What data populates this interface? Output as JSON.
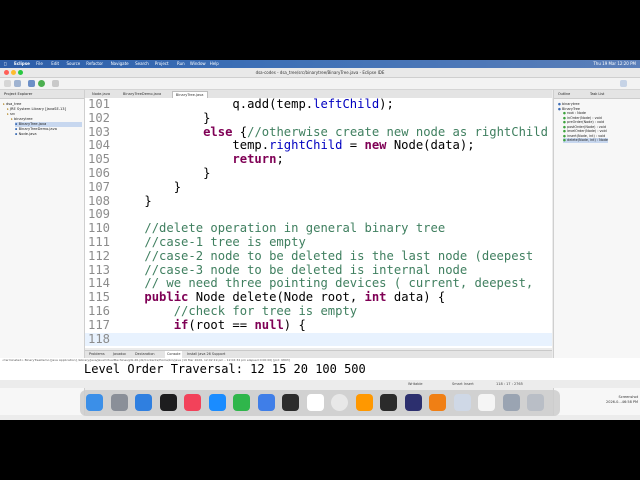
{
  "menubar": {
    "items": [
      "Eclipse",
      "File",
      "Edit",
      "Source",
      "Refactor",
      "Navigate",
      "Search",
      "Project",
      "Run",
      "Window",
      "Help"
    ],
    "clock": "Thu 19 Mar 12:20 PM"
  },
  "window": {
    "title": "dsa-codes - dsa_tree/src/binarytree/BinaryTree.java - Eclipse IDE"
  },
  "colors": {
    "menubar": "#2d5ea8",
    "keyword": "#7f0055",
    "comment": "#3f7f5f",
    "field": "#0000c0",
    "line_number": "#8c8c8c",
    "selection": "#c7d7ef"
  },
  "project_explorer": {
    "title": "Project Explorer",
    "items": [
      {
        "label": "dsa_tree",
        "depth": 0
      },
      {
        "label": "JRE System Library [JavaSE-13]",
        "depth": 1
      },
      {
        "label": "src",
        "depth": 1
      },
      {
        "label": "binarytree",
        "depth": 2
      },
      {
        "label": "BinaryTree.java",
        "depth": 3,
        "selected": true
      },
      {
        "label": "BinaryTreeDemo.java",
        "depth": 3
      },
      {
        "label": "Node.java",
        "depth": 3
      }
    ]
  },
  "editor_tabs": [
    "Node.java",
    "BinaryTreeDemo.java",
    "BinaryTree.java"
  ],
  "active_tab": "BinaryTree.java",
  "code": [
    {
      "n": "101",
      "indent": "                ",
      "parts": [
        {
          "t": "q.add(temp."
        },
        {
          "t": "leftChild",
          "c": "fld"
        },
        {
          "t": ");"
        }
      ]
    },
    {
      "n": "102",
      "indent": "            ",
      "parts": [
        {
          "t": "}"
        }
      ]
    },
    {
      "n": "103",
      "indent": "            ",
      "parts": [
        {
          "t": "else",
          "c": "kw"
        },
        {
          "t": " {"
        },
        {
          "t": "//otherwise create new node as rightChild",
          "c": "cm"
        }
      ]
    },
    {
      "n": "104",
      "indent": "                ",
      "parts": [
        {
          "t": "temp."
        },
        {
          "t": "rightChild",
          "c": "fld"
        },
        {
          "t": " = "
        },
        {
          "t": "new",
          "c": "kw"
        },
        {
          "t": " Node(data);"
        }
      ]
    },
    {
      "n": "105",
      "indent": "                ",
      "parts": [
        {
          "t": "return",
          "c": "kw"
        },
        {
          "t": ";"
        }
      ]
    },
    {
      "n": "106",
      "indent": "            ",
      "parts": [
        {
          "t": "}"
        }
      ]
    },
    {
      "n": "107",
      "indent": "        ",
      "parts": [
        {
          "t": "}"
        }
      ]
    },
    {
      "n": "108",
      "indent": "    ",
      "parts": [
        {
          "t": "}"
        }
      ]
    },
    {
      "n": "109",
      "indent": "",
      "parts": []
    },
    {
      "n": "110",
      "indent": "    ",
      "parts": [
        {
          "t": "//delete operation in general binary tree",
          "c": "cm"
        }
      ]
    },
    {
      "n": "111",
      "indent": "    ",
      "parts": [
        {
          "t": "//case-1 tree is empty",
          "c": "cm"
        }
      ]
    },
    {
      "n": "112",
      "indent": "    ",
      "parts": [
        {
          "t": "//case-2 node to be deleted is the last node (deepest",
          "c": "cm"
        }
      ]
    },
    {
      "n": "113",
      "indent": "    ",
      "parts": [
        {
          "t": "//case-3 node to be deleted is internal node",
          "c": "cm"
        }
      ]
    },
    {
      "n": "114",
      "indent": "    ",
      "parts": [
        {
          "t": "// we need three pointing devices ( current, deepest,",
          "c": "cm"
        }
      ]
    },
    {
      "n": "115",
      "indent": "    ",
      "parts": [
        {
          "t": "public",
          "c": "kw"
        },
        {
          "t": " Node delete(Node root, "
        },
        {
          "t": "int",
          "c": "kw"
        },
        {
          "t": " data) {"
        }
      ]
    },
    {
      "n": "116",
      "indent": "        ",
      "parts": [
        {
          "t": "//check for tree is empty",
          "c": "cm"
        }
      ]
    },
    {
      "n": "117",
      "indent": "        ",
      "parts": [
        {
          "t": "if",
          "c": "kw"
        },
        {
          "t": "(root == "
        },
        {
          "t": "null",
          "c": "kw"
        },
        {
          "t": ") {"
        }
      ]
    },
    {
      "n": "118",
      "indent": "",
      "parts": [],
      "current": true
    }
  ],
  "outline": {
    "tabs": [
      "Outline",
      "Task List"
    ],
    "items": [
      {
        "label": "binarytree"
      },
      {
        "label": "BinaryTree"
      },
      {
        "label": "root : Node"
      },
      {
        "label": "inOrder(Node) : void"
      },
      {
        "label": "preOrder(Node) : void"
      },
      {
        "label": "postOrder(Node) : void"
      },
      {
        "label": "levelOrder(Node) : void"
      },
      {
        "label": "insert(Node, int) : void"
      },
      {
        "label": "delete(Node, int) : Node",
        "selected": true
      }
    ]
  },
  "bottom_tabs": [
    "Problems",
    "Javadoc",
    "Declaration",
    "Console",
    "Install Java 26 Support"
  ],
  "active_bottom_tab": "Console",
  "console": {
    "header": "<terminated> BinaryTreeDemo [Java Application] /Library/Java/JavaVirtualMachines/jdk-26.jdk/Contents/Home/bin/java (19 Mar 2026, 12:02:19 pm – 12:02:34 pm elapsed 0:00:00) [pid: 9893]",
    "output": "Level Order Traversal: 12 15 20 100 500"
  },
  "status": {
    "mode": "Writable",
    "insert": "Smart Insert",
    "position": "118 : 17 : 2765"
  },
  "desktop_label": {
    "title": "Screenshot",
    "date": "2026-0...46:58 PM"
  },
  "dock": {
    "apps": [
      "finder-icon",
      "launchpad-icon",
      "safari-icon",
      "apple-tv-icon",
      "music-icon",
      "app-store-icon",
      "numbers-icon",
      "keynote-icon",
      "quicktime-icon",
      "calendar-icon",
      "chrome-icon",
      "sublime-icon",
      "terminal-icon",
      "eclipse-icon",
      "vlc-icon",
      "preview-icon",
      "music-file-icon",
      "downloads-icon",
      "trash-icon"
    ]
  }
}
